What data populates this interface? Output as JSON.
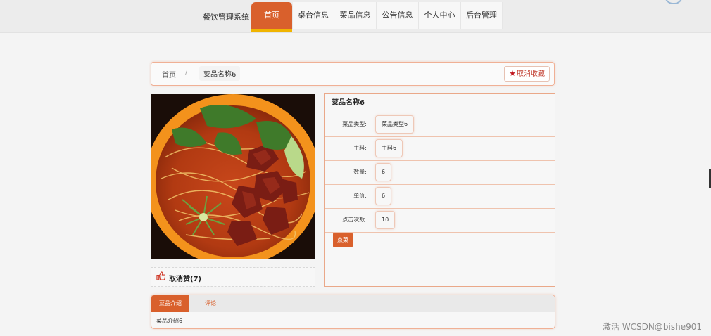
{
  "nav": {
    "brand": "餐饮管理系统",
    "items": [
      {
        "label": "首页",
        "active": true
      },
      {
        "label": "桌台信息"
      },
      {
        "label": "菜品信息"
      },
      {
        "label": "公告信息"
      },
      {
        "label": "个人中心"
      },
      {
        "label": "后台管理"
      }
    ],
    "accent": "#d9602c",
    "underline": "#f0b400"
  },
  "breadcrumb": {
    "home": "首页",
    "separator": "/",
    "current": "菜品名称6"
  },
  "favorite_button": {
    "icon": "star-icon",
    "label": "取消收藏"
  },
  "like": {
    "icon": "thumbs-up-icon",
    "label": "取消赞(7)"
  },
  "detail": {
    "title": "菜品名称6",
    "fields": [
      {
        "label": "菜品类型:",
        "value": "菜品类型6"
      },
      {
        "label": "主料:",
        "value": "主料6"
      },
      {
        "label": "数量:",
        "value": "6"
      },
      {
        "label": "单价:",
        "value": "6"
      },
      {
        "label": "点击次数:",
        "value": "10"
      }
    ],
    "order_button": "点菜"
  },
  "tabs": {
    "items": [
      {
        "label": "菜品介绍",
        "active": true
      },
      {
        "label": "评论"
      }
    ],
    "content": "菜品介绍6"
  },
  "watermark": "激活 WCSDN@bishe901"
}
